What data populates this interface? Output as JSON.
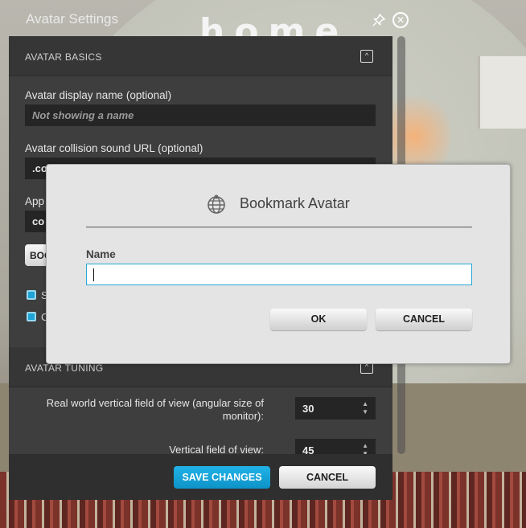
{
  "window": {
    "title": "Avatar Settings",
    "pin_icon": "pin-icon",
    "close_icon": "close-icon"
  },
  "scene": {
    "sign_text": "home"
  },
  "sections": {
    "basics": {
      "label": "AVATAR BASICS",
      "toggle_glyph": "^"
    },
    "tuning": {
      "label": "AVATAR TUNING",
      "toggle_glyph": "^"
    }
  },
  "fields": {
    "display_name": {
      "label": "Avatar display name (optional)",
      "placeholder": "Not showing a name"
    },
    "collision_sound": {
      "label": "Avatar collision sound URL (optional)",
      "value": ".co"
    },
    "appearance": {
      "label": "App",
      "value": "co"
    },
    "bookmark_button": "BOO",
    "checkbox_1": "S",
    "checkbox_2": "C"
  },
  "tuning": {
    "real_world_fov": {
      "label": "Real world vertical field of view (angular size of monitor):",
      "value": "30"
    },
    "vertical_fov": {
      "label": "Vertical field of view:",
      "value": "45"
    }
  },
  "footer": {
    "save_label": "SAVE CHANGES",
    "cancel_label": "CANCEL"
  },
  "modal": {
    "icon": "globe-icon",
    "title": "Bookmark Avatar",
    "name_label": "Name",
    "name_value": "",
    "ok_label": "OK",
    "cancel_label": "CANCEL"
  },
  "colors": {
    "accent": "#1fa4d6",
    "panel_bg": "#3e3e3e",
    "modal_bg": "#e4e4e4"
  }
}
